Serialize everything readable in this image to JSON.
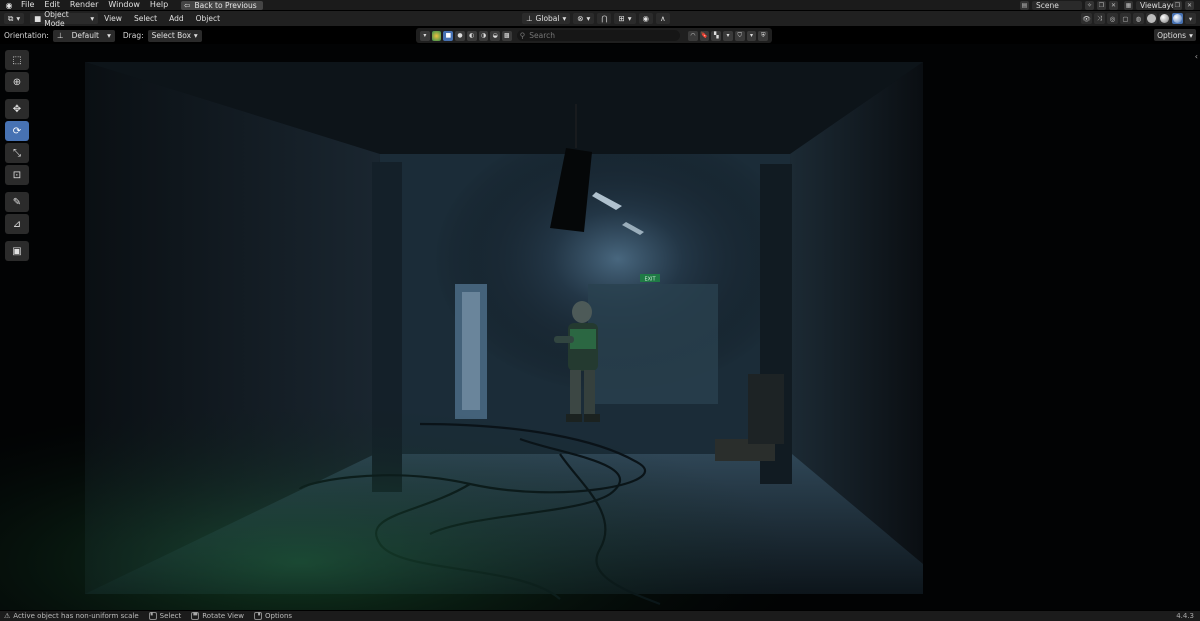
{
  "menubar": {
    "items": [
      "File",
      "Edit",
      "Render",
      "Window",
      "Help"
    ],
    "back_button": "Back to Previous",
    "scene": "Scene",
    "view_layer": "ViewLayer"
  },
  "header": {
    "mode": "Object Mode",
    "menus": [
      "View",
      "Select",
      "Add",
      "Object"
    ],
    "orientation_global": "Global"
  },
  "tool_settings": {
    "orientation_label": "Orientation:",
    "orientation_value": "Default",
    "drag_label": "Drag:",
    "drag_value": "Select Box",
    "options": "Options"
  },
  "outliner_bar": {
    "search_placeholder": "Search"
  },
  "toolbar": {
    "tools": [
      {
        "name": "select-box-tool",
        "glyph": "⬚"
      },
      {
        "name": "cursor-tool",
        "glyph": "⊕"
      },
      {
        "name": "move-tool",
        "glyph": "✥"
      },
      {
        "name": "rotate-tool",
        "glyph": "⟳"
      },
      {
        "name": "scale-tool",
        "glyph": "⤡"
      },
      {
        "name": "transform-tool",
        "glyph": "⊡"
      },
      {
        "name": "annotate-tool",
        "glyph": "✎"
      },
      {
        "name": "measure-tool",
        "glyph": "⊿"
      },
      {
        "name": "add-cube-tool",
        "glyph": "▣"
      }
    ],
    "active_index": 3
  },
  "statusbar": {
    "warning": "Active object has non-uniform scale",
    "select": "Select",
    "rotate_view": "Rotate View",
    "options": "Options",
    "version": "4.4.3"
  },
  "scene_text": {
    "exit_sign": "EXIT"
  },
  "colors": {
    "accent": "#4772b3",
    "panel": "#2b2b2b",
    "bar": "#1b1b1b"
  }
}
